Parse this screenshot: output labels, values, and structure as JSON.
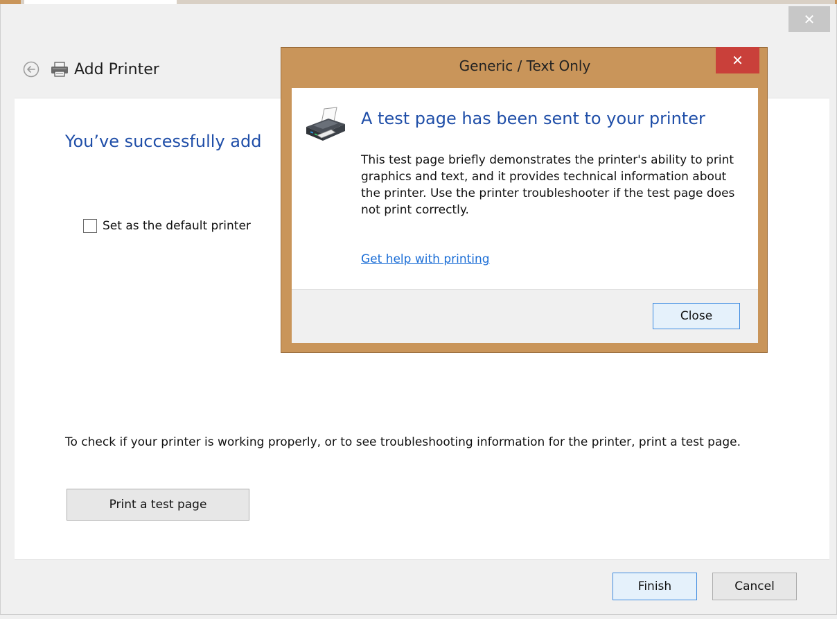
{
  "wizard": {
    "title": "Add Printer",
    "close_glyph": "✕",
    "success_heading": "You’ve successfully add",
    "default_printer_label": "Set as the default printer",
    "default_printer_checked": false,
    "info_text": "To check if your printer is working properly, or to see troubleshooting information for the printer, print a test page.",
    "print_test_label": "Print a test page",
    "finish_label": "Finish",
    "cancel_label": "Cancel"
  },
  "dialog": {
    "title": "Generic / Text Only",
    "close_glyph": "✕",
    "heading": "A test page has been sent to your printer",
    "description": "This test page briefly demonstrates the printer's ability to print graphics and text, and it provides technical information about the printer. Use the printer troubleshooter if the test page does not print correctly.",
    "help_link": "Get help with printing",
    "close_label": "Close"
  },
  "colors": {
    "dialog_frame": "#c9955a",
    "close_red": "#c9403a",
    "heading_blue": "#1f4ea8",
    "link_blue": "#1a6dd6"
  },
  "icons": [
    "back-arrow-icon",
    "printer-icon",
    "close-icon"
  ]
}
